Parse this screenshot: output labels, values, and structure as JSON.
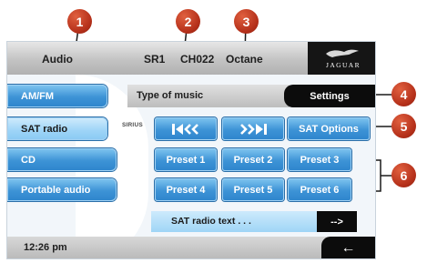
{
  "header": {
    "source_label": "Audio",
    "band": "SR1",
    "channel": "CH022",
    "channel_name": "Octane",
    "brand": "JAGUAR"
  },
  "sidebar": {
    "items": [
      {
        "label": "AM/FM",
        "selected": false
      },
      {
        "label": "SAT radio",
        "selected": true
      },
      {
        "label": "CD",
        "selected": false
      },
      {
        "label": "Portable audio",
        "selected": false
      }
    ]
  },
  "main": {
    "type_of_music_label": "Type of music",
    "settings_label": "Settings",
    "sirius_logo_text": "SIRIUS",
    "sat_options_label": "SAT Options",
    "presets": [
      "Preset 1",
      "Preset 2",
      "Preset 3",
      "Preset 4",
      "Preset 5",
      "Preset 6"
    ],
    "sat_radio_text_label": "SAT radio text . . .",
    "more_label": "-->"
  },
  "footer": {
    "time": "12:26 pm",
    "back_glyph": "←"
  },
  "callouts": [
    "1",
    "2",
    "3",
    "4",
    "5",
    "6"
  ],
  "colors": {
    "button_blue": "#3d93d6",
    "selected_blue": "#9dd4f7",
    "callout_red": "#b5301a",
    "dark_panel": "#0c0c0c"
  },
  "icons": {
    "previous": "skip-previous-icon",
    "next": "skip-next-icon",
    "back": "back-arrow-icon",
    "leaper": "jaguar-leaper-logo"
  }
}
